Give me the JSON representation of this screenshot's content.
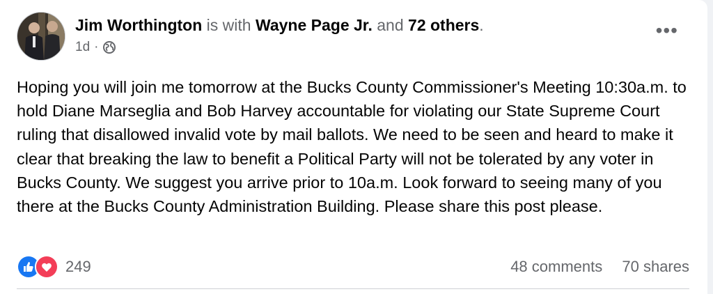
{
  "post": {
    "author": "Jim Worthington",
    "with_text": "is with",
    "tagged_person": "Wayne Page Jr.",
    "and_text": "and",
    "others": "72 others",
    "period": ".",
    "time": "1d",
    "privacy_icon": "globe-icon",
    "more_icon": "more-options-icon",
    "text": "Hoping you will join me tomorrow at the Bucks County Commissioner's Meeting 10:30a.m. to hold Diane Marseglia and Bob Harvey accountable for violating our State Supreme Court ruling that disallowed invalid vote by mail ballots. We need to be seen and heard to make it clear that breaking the law to benefit a Political Party will not be tolerated by any voter in Bucks County. We suggest you arrive prior to 10a.m. Look forward to seeing many of you there at the Bucks County Administration Building. Please share this post please."
  },
  "footer": {
    "reaction_icons": [
      "like-icon",
      "love-icon"
    ],
    "reaction_count": "249",
    "comments": "48 comments",
    "shares": "70 shares"
  },
  "colors": {
    "like_blue": "#1877f2",
    "love_red": "#f33e58",
    "secondary_text": "#65676b"
  }
}
